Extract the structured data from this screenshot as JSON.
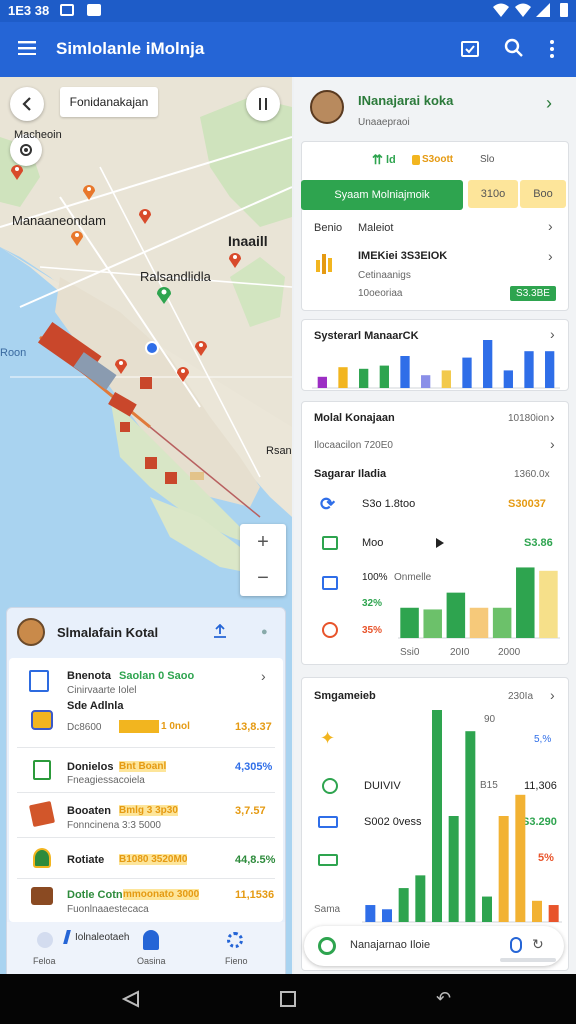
{
  "status": {
    "time": "1E3 38"
  },
  "app": {
    "title": "Simlolanle iMolnja"
  },
  "map": {
    "search_label": "Fonidanakajan",
    "labels": [
      "Macheoin",
      "Manaaneondam",
      "Inaaill",
      "Ralsandlidla",
      "Roon",
      "Rsan"
    ]
  },
  "sheet": {
    "title": "Slmalafain Kotal",
    "items": [
      {
        "title": "Bnenota",
        "accent": "Saolan 0 Saoo",
        "sub": "Cinirvaarte Iolel",
        "icon_color": "#2d6be0"
      },
      {
        "title": "Sde Adlnla",
        "accent": "1 0nol",
        "sub": "Dc8600",
        "value": "13,8.37",
        "icon_color": "#3a59c9"
      },
      {
        "title": "Donielos",
        "accent": "Bnt Boanl",
        "sub": "Fneagiessacoiela",
        "value": "4,305%",
        "icon_color": "#2b9a3a"
      },
      {
        "title": "Booaten",
        "accent": "Bmlg 3 3p30",
        "sub": "Fonncinena 3:3 5000",
        "value": "3,7.57",
        "icon_color": "#d2562a"
      },
      {
        "title": "Rotiate",
        "accent": "B1080 3520M0",
        "sub": "",
        "value": "44,8.5%",
        "icon_color": "#2e8b3c"
      },
      {
        "title": "Dotle Cotn",
        "accent": "mmoonato 3000",
        "sub": "Fuonlnaaestecaca",
        "value": "11,1536",
        "icon_color": "#8a4a22"
      }
    ],
    "bottom_tabs": [
      {
        "label": "Feloa"
      },
      {
        "label": "Oasina"
      },
      {
        "label": "Fieno"
      }
    ],
    "bottom_tab_caption": "Iolnaleotaeh"
  },
  "profile": {
    "name": "INanajarai koka",
    "sub": "Unaaepraoi"
  },
  "summary": {
    "m1": "ld",
    "m2": "S3oott",
    "m3": "Slo",
    "primary": "Syaam Molniajmoik",
    "chip1": "310o",
    "chip2": "Boo",
    "row_label": "Benio",
    "row_value": "Maleiot",
    "item_title": "IMEKiei 3S3EIOK",
    "item_sub1": "Cetinaanigs",
    "item_sub2": "10oeoriaa",
    "badge": "S3.3BE"
  },
  "chart1": {
    "title": "Systerarl ManaarCK"
  },
  "detail": {
    "l1": "Molal Konajaan",
    "v1": "10180ion",
    "l2": "Ilocaacilon 720E0",
    "section": "Sagarar Iladia",
    "section_val": "1360.0x",
    "rows": [
      {
        "label": "S3o 1.8too",
        "value": "S30037"
      },
      {
        "label": "Moo",
        "value": "S3.86"
      },
      {
        "label": "100%",
        "sub": "Onmelle"
      },
      {
        "label": "32%"
      },
      {
        "label": "35%"
      }
    ],
    "xticks": [
      "Ssi0",
      "20I0",
      "2000"
    ]
  },
  "bottom": {
    "title": "Smgameieb",
    "title_val": "230Ia",
    "top_val": "90",
    "pct": "5,%",
    "r1_label": "DUIVIV",
    "r1_mid": "B15",
    "r1_val": "11,306",
    "r2_label": "S002 0vess",
    "r2_val": "S3.290",
    "r3_val": "5%",
    "footer_label": "Sama",
    "search_label": "Nanajarnao Iloie"
  },
  "chart_data": [
    {
      "type": "bar",
      "title": "Systerarl ManaarCK",
      "categories": [
        "1",
        "2",
        "3",
        "4",
        "5",
        "6",
        "7",
        "8",
        "9",
        "10",
        "11",
        "12"
      ],
      "series": [
        {
          "values": [
            14,
            26,
            24,
            28,
            40,
            16,
            22,
            38,
            60,
            22,
            46,
            46
          ]
        }
      ],
      "colors": [
        "#9c2ec4",
        "#f2b51f",
        "#2ea44f",
        "#2ea44f",
        "#2f6ee8",
        "#8a8fe8",
        "#f2c94c",
        "#2f6ee8",
        "#2f6ee8",
        "#2f6ee8",
        "#2f6ee8",
        "#2f6ee8"
      ],
      "ylim": [
        0,
        60
      ]
    },
    {
      "type": "bar",
      "categories": [
        "Ssi0",
        "20I0",
        "2000"
      ],
      "series": [
        {
          "values": [
            36,
            34,
            54,
            36,
            36,
            84,
            80
          ]
        }
      ],
      "colors": [
        "#2ea44f",
        "#6cc16a",
        "#2ea44f",
        "#f6c97a",
        "#6cc16a",
        "#2ea44f",
        "#f6e08a"
      ],
      "ylim": [
        0,
        100
      ]
    },
    {
      "type": "bar",
      "series": [
        {
          "values": [
            8,
            6,
            16,
            22,
            100,
            50,
            90,
            12,
            50,
            60,
            10,
            8
          ]
        }
      ],
      "colors": [
        "#2f6ee8",
        "#2f6ee8",
        "#2ea44f",
        "#2ea44f",
        "#2ea44f",
        "#2ea44f",
        "#2ea44f",
        "#2ea44f",
        "#f2b233",
        "#f2b233",
        "#f2b233",
        "#e8542b"
      ],
      "ylim": [
        0,
        100
      ]
    }
  ]
}
